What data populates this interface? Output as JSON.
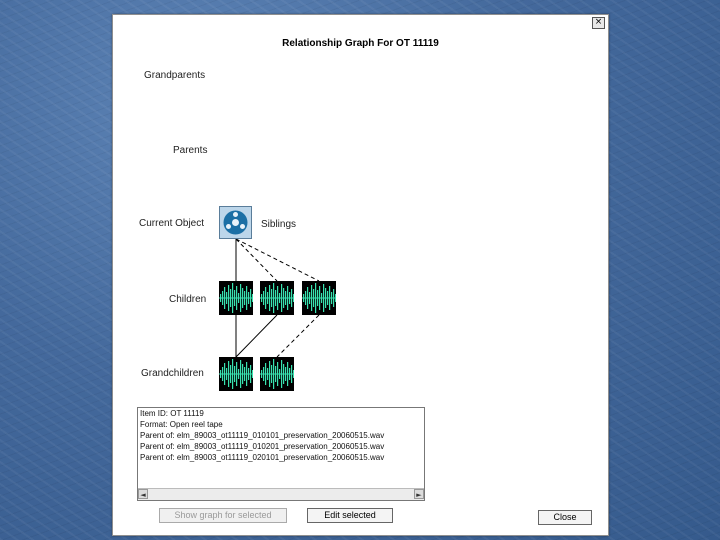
{
  "dialog": {
    "title": "Relationship Graph For OT 11119",
    "close_glyph": "×"
  },
  "levels": {
    "grandparents": "Grandparents",
    "parents": "Parents",
    "current": "Current Object",
    "siblings": "Siblings",
    "children": "Children",
    "grandchildren": "Grandchildren"
  },
  "icons": {
    "current_object": "open-reel-tape-icon",
    "child": "audio-waveform-icon",
    "grandchild": "audio-waveform-icon"
  },
  "colors": {
    "waveform": "#39e3b0",
    "reel_bg": "#bcd6ea",
    "reel": "#1b6fa5"
  },
  "info": {
    "lines": [
      "Item ID: OT 11119",
      "Format: Open reel tape",
      "Parent of: elm_89003_ot11119_010101_preservation_20060515.wav",
      "Parent of: elm_89003_ot11119_010201_preservation_20060515.wav",
      "Parent of: elm_89003_ot11119_020101_preservation_20060515.wav"
    ]
  },
  "scroll": {
    "left_glyph": "◄",
    "right_glyph": "►"
  },
  "buttons": {
    "show_graph": "Show graph for selected",
    "edit_selected": "Edit selected",
    "close": "Close"
  }
}
